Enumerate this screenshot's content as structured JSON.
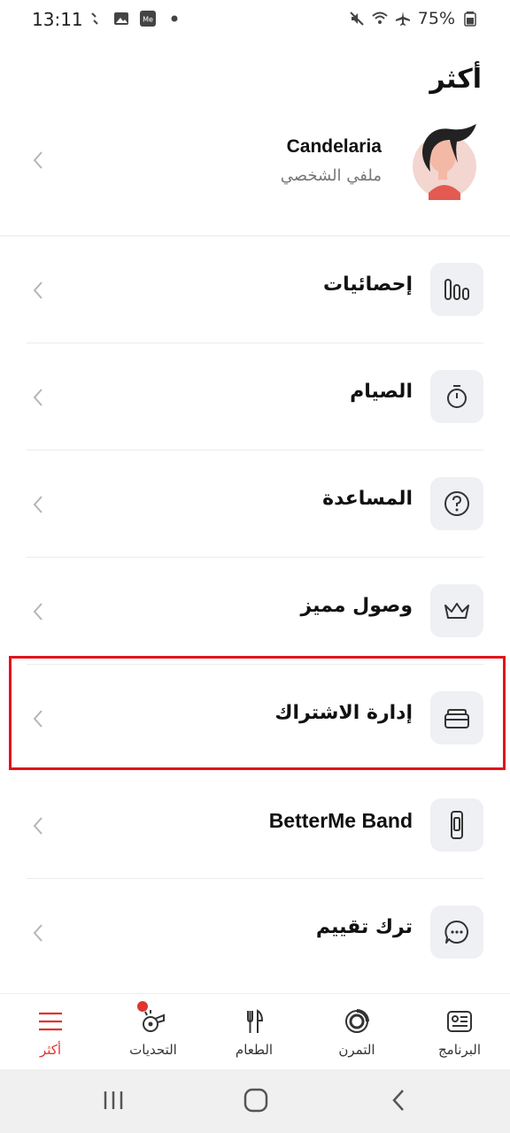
{
  "status_bar": {
    "time": "13:11",
    "battery": "75%",
    "left_icons": [
      "sync-icon",
      "image-icon",
      "me-app-icon",
      "dot-icon"
    ],
    "right_icons": [
      "mute-icon",
      "wifi-icon",
      "airplane-icon",
      "battery-icon"
    ],
    "me_badge": "Me"
  },
  "page": {
    "title": "أكثر"
  },
  "profile": {
    "name": "Candelaria",
    "subtitle": "ملفي الشخصي"
  },
  "menu": [
    {
      "label": "إحصائيات",
      "icon": "stats-bars-icon"
    },
    {
      "label": "الصيام",
      "icon": "stopwatch-icon"
    },
    {
      "label": "المساعدة",
      "icon": "help-circle-icon"
    },
    {
      "label": "وصول مميز",
      "icon": "crown-icon"
    },
    {
      "label": "إدارة الاشتراك",
      "icon": "subscription-stack-icon"
    },
    {
      "label": "BetterMe Band",
      "icon": "smart-band-icon"
    },
    {
      "label": "ترك تقييم",
      "icon": "chat-bubble-icon"
    }
  ],
  "bottom_nav": [
    {
      "label": "البرنامج",
      "icon": "program-card-icon",
      "active": false
    },
    {
      "label": "التمرن",
      "icon": "workout-ring-icon",
      "active": false
    },
    {
      "label": "الطعام",
      "icon": "fork-knife-icon",
      "active": false
    },
    {
      "label": "التحديات",
      "icon": "whistle-icon",
      "active": false,
      "badge": true
    },
    {
      "label": "أكثر",
      "icon": "menu-icon",
      "active": true
    }
  ],
  "colors": {
    "accent": "#e0342f",
    "highlight": "#e0141a",
    "icon_bg": "#eef0f4"
  }
}
